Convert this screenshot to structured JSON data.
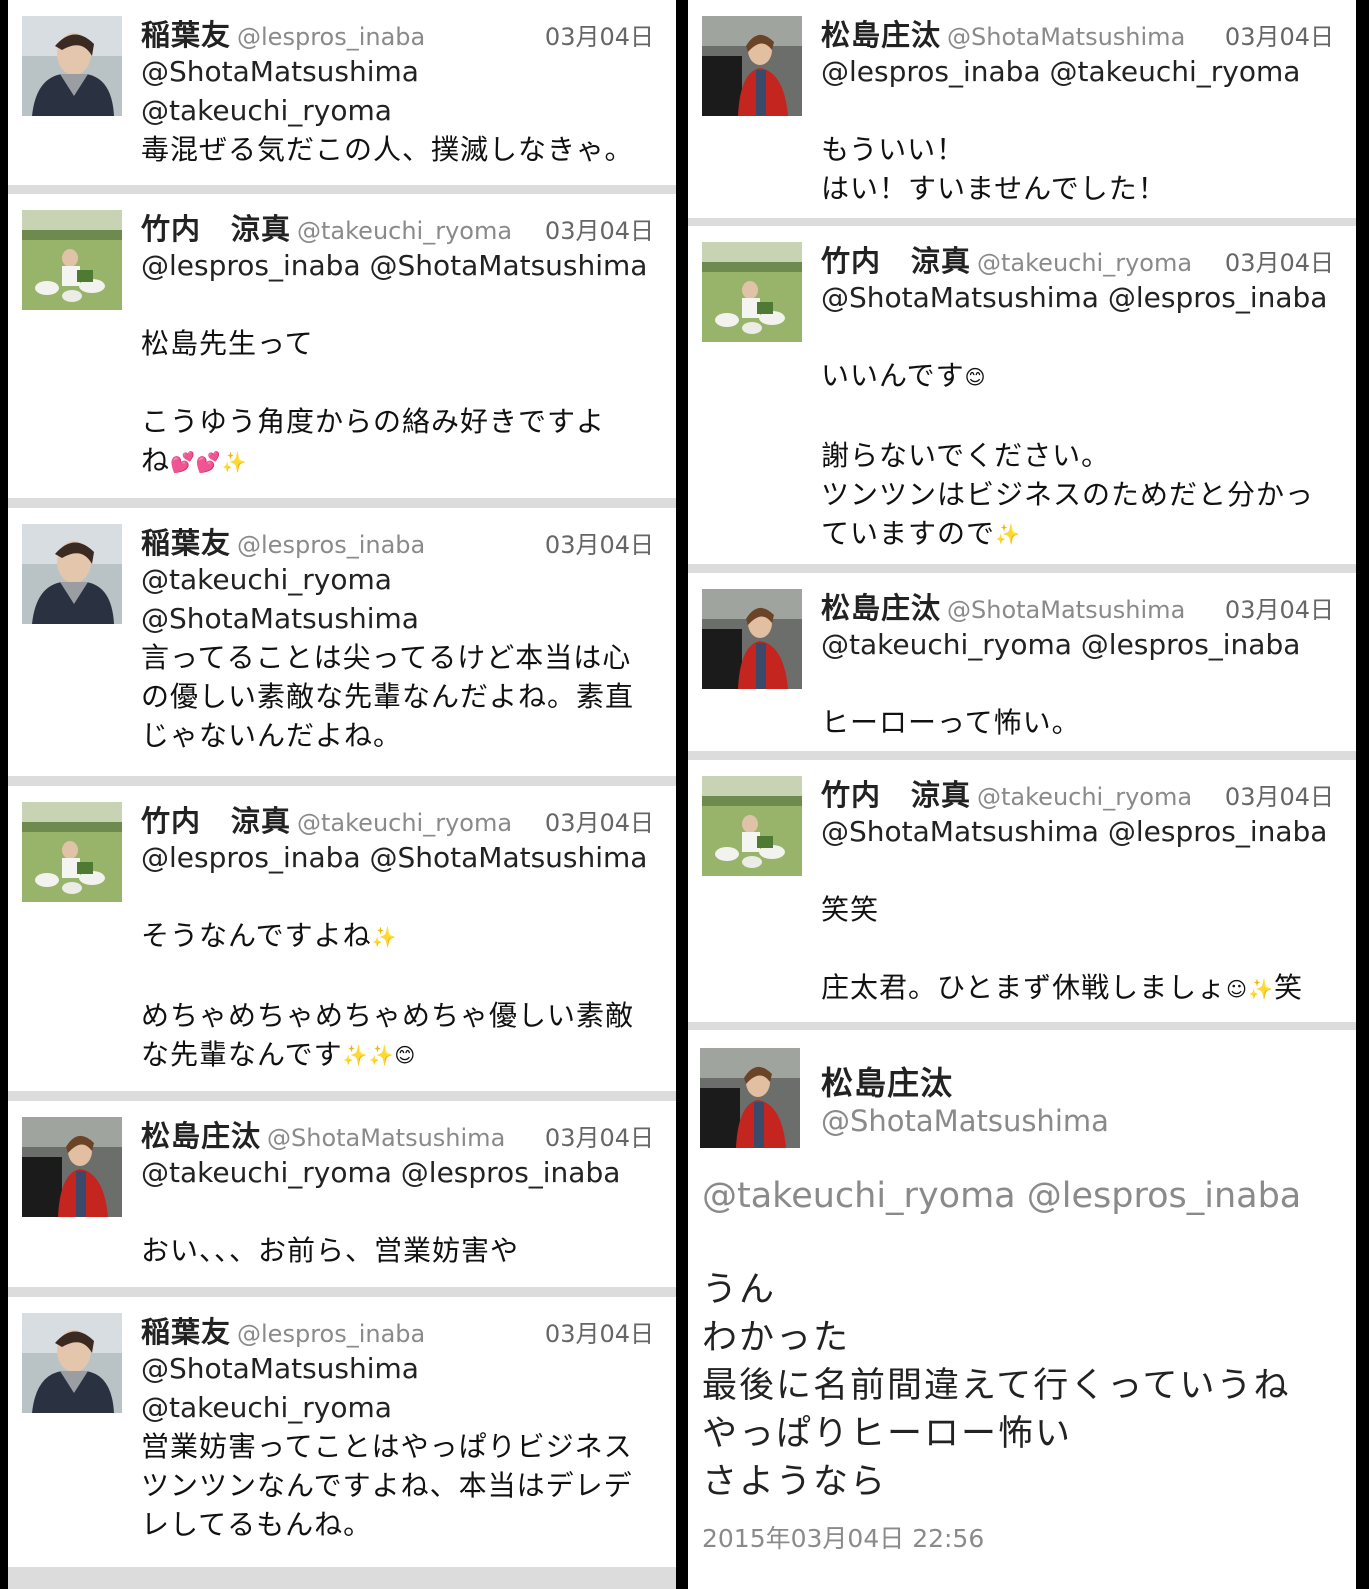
{
  "left_column": [
    {
      "user": "inaba",
      "name": "稲葉友",
      "handle": "@lespros_inaba",
      "date": "03月04日",
      "mentions": [
        "@ShotaMatsushima",
        "@takeuchi_ryoma"
      ],
      "body": [
        "毒混ぜる気だこの人、撲滅しなきゃ。"
      ]
    },
    {
      "user": "takeuchi",
      "name": "竹内　涼真",
      "handle": "@takeuchi_ryoma",
      "date": "03月04日",
      "mentions": [
        "@lespros_inaba @ShotaMatsushima"
      ],
      "body": [
        "",
        "松島先生って",
        "",
        "こうゆう角度からの絡み好きですよ",
        "ね"
      ],
      "emoji": "💕💕✨"
    },
    {
      "user": "inaba",
      "name": "稲葉友",
      "handle": "@lespros_inaba",
      "date": "03月04日",
      "mentions": [
        "@takeuchi_ryoma",
        "@ShotaMatsushima"
      ],
      "body": [
        "言ってることは尖ってるけど本当は心",
        "の優しい素敵な先輩なんだよね。素直",
        "じゃないんだよね。"
      ]
    },
    {
      "user": "takeuchi",
      "name": "竹内　涼真",
      "handle": "@takeuchi_ryoma",
      "date": "03月04日",
      "mentions": [
        "@lespros_inaba @ShotaMatsushima"
      ],
      "body": [
        "",
        "そうなんですよね",
        "",
        "めちゃめちゃめちゃめちゃ優しい素敵",
        "な先輩なんです"
      ],
      "emoji": "✨",
      "emoji2": "✨✨😊"
    },
    {
      "user": "matsushima",
      "name": "松島庄汰",
      "handle": "@ShotaMatsushima",
      "date": "03月04日",
      "mentions": [
        "@takeuchi_ryoma @lespros_inaba"
      ],
      "body": [
        "",
        "おい、、、お前ら、営業妨害や"
      ]
    },
    {
      "user": "inaba",
      "name": "稲葉友",
      "handle": "@lespros_inaba",
      "date": "03月04日",
      "mentions": [
        "@ShotaMatsushima",
        "@takeuchi_ryoma"
      ],
      "body": [
        "営業妨害ってことはやっぱりビジネス",
        "ツンツンなんですよね、本当はデレデ",
        "レしてるもんね。"
      ]
    }
  ],
  "right_column": [
    {
      "user": "matsushima",
      "name": "松島庄汰",
      "handle": "@ShotaMatsushima",
      "date": "03月04日",
      "mentions": [
        "@lespros_inaba @takeuchi_ryoma"
      ],
      "body": [
        "",
        "もういい！",
        "はい！すいませんでした！"
      ]
    },
    {
      "user": "takeuchi",
      "name": "竹内　涼真",
      "handle": "@takeuchi_ryoma",
      "date": "03月04日",
      "mentions": [
        "@ShotaMatsushima @lespros_inaba"
      ],
      "body": [
        "",
        "いいんです",
        "",
        "謝らないでください。",
        "ツンツンはビジネスのためだと分かっ",
        "ていますので"
      ],
      "emoji": "😊",
      "emoji2": "✨"
    },
    {
      "user": "matsushima",
      "name": "松島庄汰",
      "handle": "@ShotaMatsushima",
      "date": "03月04日",
      "mentions": [
        "@takeuchi_ryoma @lespros_inaba"
      ],
      "body": [
        "",
        "ヒーローって怖い。"
      ]
    },
    {
      "user": "takeuchi",
      "name": "竹内　涼真",
      "handle": "@takeuchi_ryoma",
      "date": "03月04日",
      "mentions": [
        "@ShotaMatsushima @lespros_inaba"
      ],
      "body": [
        "",
        "笑笑",
        "",
        "庄太君。ひとまず休戦しましょ"
      ],
      "emoji": "☺✨",
      "tail": "笑"
    }
  ],
  "detail": {
    "name": "松島庄汰",
    "handle": "@ShotaMatsushima",
    "mentions": "@takeuchi_ryoma @lespros_inaba",
    "body": [
      "うん",
      "わかった",
      "最後に名前間違えて行くっていうね",
      "やっぱりヒーロー怖い",
      "さようなら"
    ],
    "timestamp": "2015年03月04日 22:56"
  },
  "icons": {
    "avatar_inaba": "profile-photo-hooded-man",
    "avatar_takeuchi": "profile-photo-goats-field",
    "avatar_matsushima": "profile-photo-red-jacket"
  },
  "colors": {
    "background": "#000000",
    "card": "#ffffff",
    "divider": "#dcdcdc",
    "handle": "#8a8a8a"
  }
}
